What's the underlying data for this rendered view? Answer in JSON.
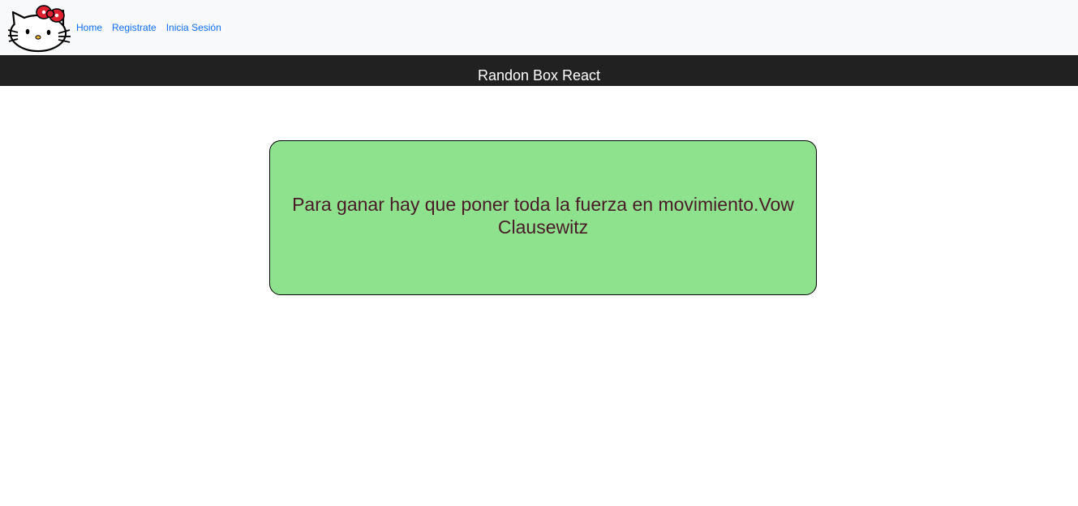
{
  "navbar": {
    "logo_icon": "hello-kitty-logo",
    "links": [
      {
        "label": "Home"
      },
      {
        "label": "Registrate"
      },
      {
        "label": "Inicia Sesión"
      }
    ],
    "link_color": "#0d6efd",
    "background": "#f8f9fa"
  },
  "header": {
    "title": "Randon Box React",
    "background": "#212121"
  },
  "quote_box": {
    "text": "Para ganar hay que poner toda la fuerza en movimiento.Vow Clausewitz",
    "background": "#8ee28e",
    "text_color": "#4a1a28"
  }
}
